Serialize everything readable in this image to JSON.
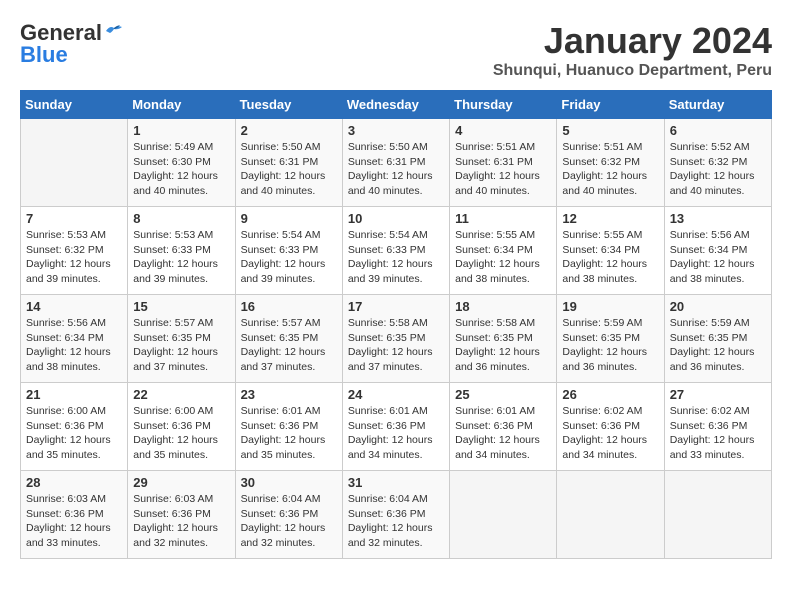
{
  "header": {
    "logo_general": "General",
    "logo_blue": "Blue",
    "title": "January 2024",
    "subtitle": "Shunqui, Huanuco Department, Peru"
  },
  "days_of_week": [
    "Sunday",
    "Monday",
    "Tuesday",
    "Wednesday",
    "Thursday",
    "Friday",
    "Saturday"
  ],
  "weeks": [
    [
      {
        "day": "",
        "sunrise": "",
        "sunset": "",
        "daylight": ""
      },
      {
        "day": "1",
        "sunrise": "Sunrise: 5:49 AM",
        "sunset": "Sunset: 6:30 PM",
        "daylight": "Daylight: 12 hours and 40 minutes."
      },
      {
        "day": "2",
        "sunrise": "Sunrise: 5:50 AM",
        "sunset": "Sunset: 6:31 PM",
        "daylight": "Daylight: 12 hours and 40 minutes."
      },
      {
        "day": "3",
        "sunrise": "Sunrise: 5:50 AM",
        "sunset": "Sunset: 6:31 PM",
        "daylight": "Daylight: 12 hours and 40 minutes."
      },
      {
        "day": "4",
        "sunrise": "Sunrise: 5:51 AM",
        "sunset": "Sunset: 6:31 PM",
        "daylight": "Daylight: 12 hours and 40 minutes."
      },
      {
        "day": "5",
        "sunrise": "Sunrise: 5:51 AM",
        "sunset": "Sunset: 6:32 PM",
        "daylight": "Daylight: 12 hours and 40 minutes."
      },
      {
        "day": "6",
        "sunrise": "Sunrise: 5:52 AM",
        "sunset": "Sunset: 6:32 PM",
        "daylight": "Daylight: 12 hours and 40 minutes."
      }
    ],
    [
      {
        "day": "7",
        "sunrise": "Sunrise: 5:53 AM",
        "sunset": "Sunset: 6:32 PM",
        "daylight": "Daylight: 12 hours and 39 minutes."
      },
      {
        "day": "8",
        "sunrise": "Sunrise: 5:53 AM",
        "sunset": "Sunset: 6:33 PM",
        "daylight": "Daylight: 12 hours and 39 minutes."
      },
      {
        "day": "9",
        "sunrise": "Sunrise: 5:54 AM",
        "sunset": "Sunset: 6:33 PM",
        "daylight": "Daylight: 12 hours and 39 minutes."
      },
      {
        "day": "10",
        "sunrise": "Sunrise: 5:54 AM",
        "sunset": "Sunset: 6:33 PM",
        "daylight": "Daylight: 12 hours and 39 minutes."
      },
      {
        "day": "11",
        "sunrise": "Sunrise: 5:55 AM",
        "sunset": "Sunset: 6:34 PM",
        "daylight": "Daylight: 12 hours and 38 minutes."
      },
      {
        "day": "12",
        "sunrise": "Sunrise: 5:55 AM",
        "sunset": "Sunset: 6:34 PM",
        "daylight": "Daylight: 12 hours and 38 minutes."
      },
      {
        "day": "13",
        "sunrise": "Sunrise: 5:56 AM",
        "sunset": "Sunset: 6:34 PM",
        "daylight": "Daylight: 12 hours and 38 minutes."
      }
    ],
    [
      {
        "day": "14",
        "sunrise": "Sunrise: 5:56 AM",
        "sunset": "Sunset: 6:34 PM",
        "daylight": "Daylight: 12 hours and 38 minutes."
      },
      {
        "day": "15",
        "sunrise": "Sunrise: 5:57 AM",
        "sunset": "Sunset: 6:35 PM",
        "daylight": "Daylight: 12 hours and 37 minutes."
      },
      {
        "day": "16",
        "sunrise": "Sunrise: 5:57 AM",
        "sunset": "Sunset: 6:35 PM",
        "daylight": "Daylight: 12 hours and 37 minutes."
      },
      {
        "day": "17",
        "sunrise": "Sunrise: 5:58 AM",
        "sunset": "Sunset: 6:35 PM",
        "daylight": "Daylight: 12 hours and 37 minutes."
      },
      {
        "day": "18",
        "sunrise": "Sunrise: 5:58 AM",
        "sunset": "Sunset: 6:35 PM",
        "daylight": "Daylight: 12 hours and 36 minutes."
      },
      {
        "day": "19",
        "sunrise": "Sunrise: 5:59 AM",
        "sunset": "Sunset: 6:35 PM",
        "daylight": "Daylight: 12 hours and 36 minutes."
      },
      {
        "day": "20",
        "sunrise": "Sunrise: 5:59 AM",
        "sunset": "Sunset: 6:35 PM",
        "daylight": "Daylight: 12 hours and 36 minutes."
      }
    ],
    [
      {
        "day": "21",
        "sunrise": "Sunrise: 6:00 AM",
        "sunset": "Sunset: 6:36 PM",
        "daylight": "Daylight: 12 hours and 35 minutes."
      },
      {
        "day": "22",
        "sunrise": "Sunrise: 6:00 AM",
        "sunset": "Sunset: 6:36 PM",
        "daylight": "Daylight: 12 hours and 35 minutes."
      },
      {
        "day": "23",
        "sunrise": "Sunrise: 6:01 AM",
        "sunset": "Sunset: 6:36 PM",
        "daylight": "Daylight: 12 hours and 35 minutes."
      },
      {
        "day": "24",
        "sunrise": "Sunrise: 6:01 AM",
        "sunset": "Sunset: 6:36 PM",
        "daylight": "Daylight: 12 hours and 34 minutes."
      },
      {
        "day": "25",
        "sunrise": "Sunrise: 6:01 AM",
        "sunset": "Sunset: 6:36 PM",
        "daylight": "Daylight: 12 hours and 34 minutes."
      },
      {
        "day": "26",
        "sunrise": "Sunrise: 6:02 AM",
        "sunset": "Sunset: 6:36 PM",
        "daylight": "Daylight: 12 hours and 34 minutes."
      },
      {
        "day": "27",
        "sunrise": "Sunrise: 6:02 AM",
        "sunset": "Sunset: 6:36 PM",
        "daylight": "Daylight: 12 hours and 33 minutes."
      }
    ],
    [
      {
        "day": "28",
        "sunrise": "Sunrise: 6:03 AM",
        "sunset": "Sunset: 6:36 PM",
        "daylight": "Daylight: 12 hours and 33 minutes."
      },
      {
        "day": "29",
        "sunrise": "Sunrise: 6:03 AM",
        "sunset": "Sunset: 6:36 PM",
        "daylight": "Daylight: 12 hours and 32 minutes."
      },
      {
        "day": "30",
        "sunrise": "Sunrise: 6:04 AM",
        "sunset": "Sunset: 6:36 PM",
        "daylight": "Daylight: 12 hours and 32 minutes."
      },
      {
        "day": "31",
        "sunrise": "Sunrise: 6:04 AM",
        "sunset": "Sunset: 6:36 PM",
        "daylight": "Daylight: 12 hours and 32 minutes."
      },
      {
        "day": "",
        "sunrise": "",
        "sunset": "",
        "daylight": ""
      },
      {
        "day": "",
        "sunrise": "",
        "sunset": "",
        "daylight": ""
      },
      {
        "day": "",
        "sunrise": "",
        "sunset": "",
        "daylight": ""
      }
    ]
  ]
}
